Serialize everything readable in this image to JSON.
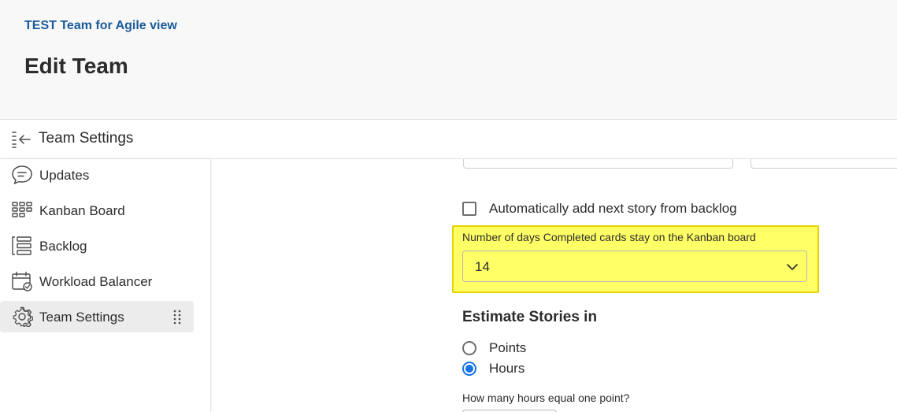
{
  "header": {
    "breadcrumb": "TEST Team for Agile view",
    "title": "Edit Team"
  },
  "sidebar": {
    "header_title": "Team Settings",
    "items": [
      {
        "label": "Updates",
        "icon": "chat-bubble-icon"
      },
      {
        "label": "Kanban Board",
        "icon": "kanban-grid-icon"
      },
      {
        "label": "Backlog",
        "icon": "backlog-list-icon"
      },
      {
        "label": "Workload Balancer",
        "icon": "calendar-check-icon"
      },
      {
        "label": "Team Settings",
        "icon": "gear-icon",
        "active": true
      }
    ]
  },
  "settings": {
    "auto_add_label": "Automatically add next story from backlog",
    "auto_add_checked": false,
    "completed_days_label": "Number of days Completed cards stay on the Kanban board",
    "completed_days_value": "14",
    "estimate_title": "Estimate Stories in",
    "estimate_options": [
      {
        "label": "Points",
        "selected": false
      },
      {
        "label": "Hours",
        "selected": true
      }
    ],
    "hours_per_point_label": "How many hours equal one point?"
  },
  "colors": {
    "highlight": "#ffff66",
    "highlight_border": "#e6d200",
    "accent": "#1473e6",
    "breadcrumb": "#1a5a9a"
  }
}
